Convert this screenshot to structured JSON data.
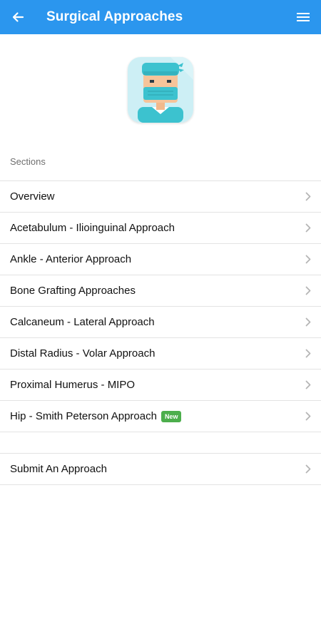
{
  "app_bar": {
    "title": "Surgical Approaches",
    "back_icon": "arrow-left-icon",
    "menu_icon": "hamburger-menu-icon",
    "background_color": "#2b96ee"
  },
  "hero": {
    "icon": "surgeon-avatar-icon"
  },
  "sections": {
    "header": "Sections",
    "items": [
      {
        "label": "Overview",
        "badge": ""
      },
      {
        "label": "Acetabulum - Ilioinguinal Approach",
        "badge": ""
      },
      {
        "label": "Ankle - Anterior Approach",
        "badge": ""
      },
      {
        "label": "Bone Grafting Approaches",
        "badge": ""
      },
      {
        "label": "Calcaneum - Lateral Approach",
        "badge": ""
      },
      {
        "label": "Distal Radius - Volar Approach",
        "badge": ""
      },
      {
        "label": "Proximal Humerus - MIPO",
        "badge": ""
      },
      {
        "label": "Hip - Smith Peterson Approach",
        "badge": "New"
      }
    ]
  },
  "submit": {
    "label": "Submit An Approach"
  },
  "colors": {
    "badge_green": "#4cae4c",
    "chevron_gray": "#b5b5b5",
    "divider": "#e3e3e3"
  }
}
